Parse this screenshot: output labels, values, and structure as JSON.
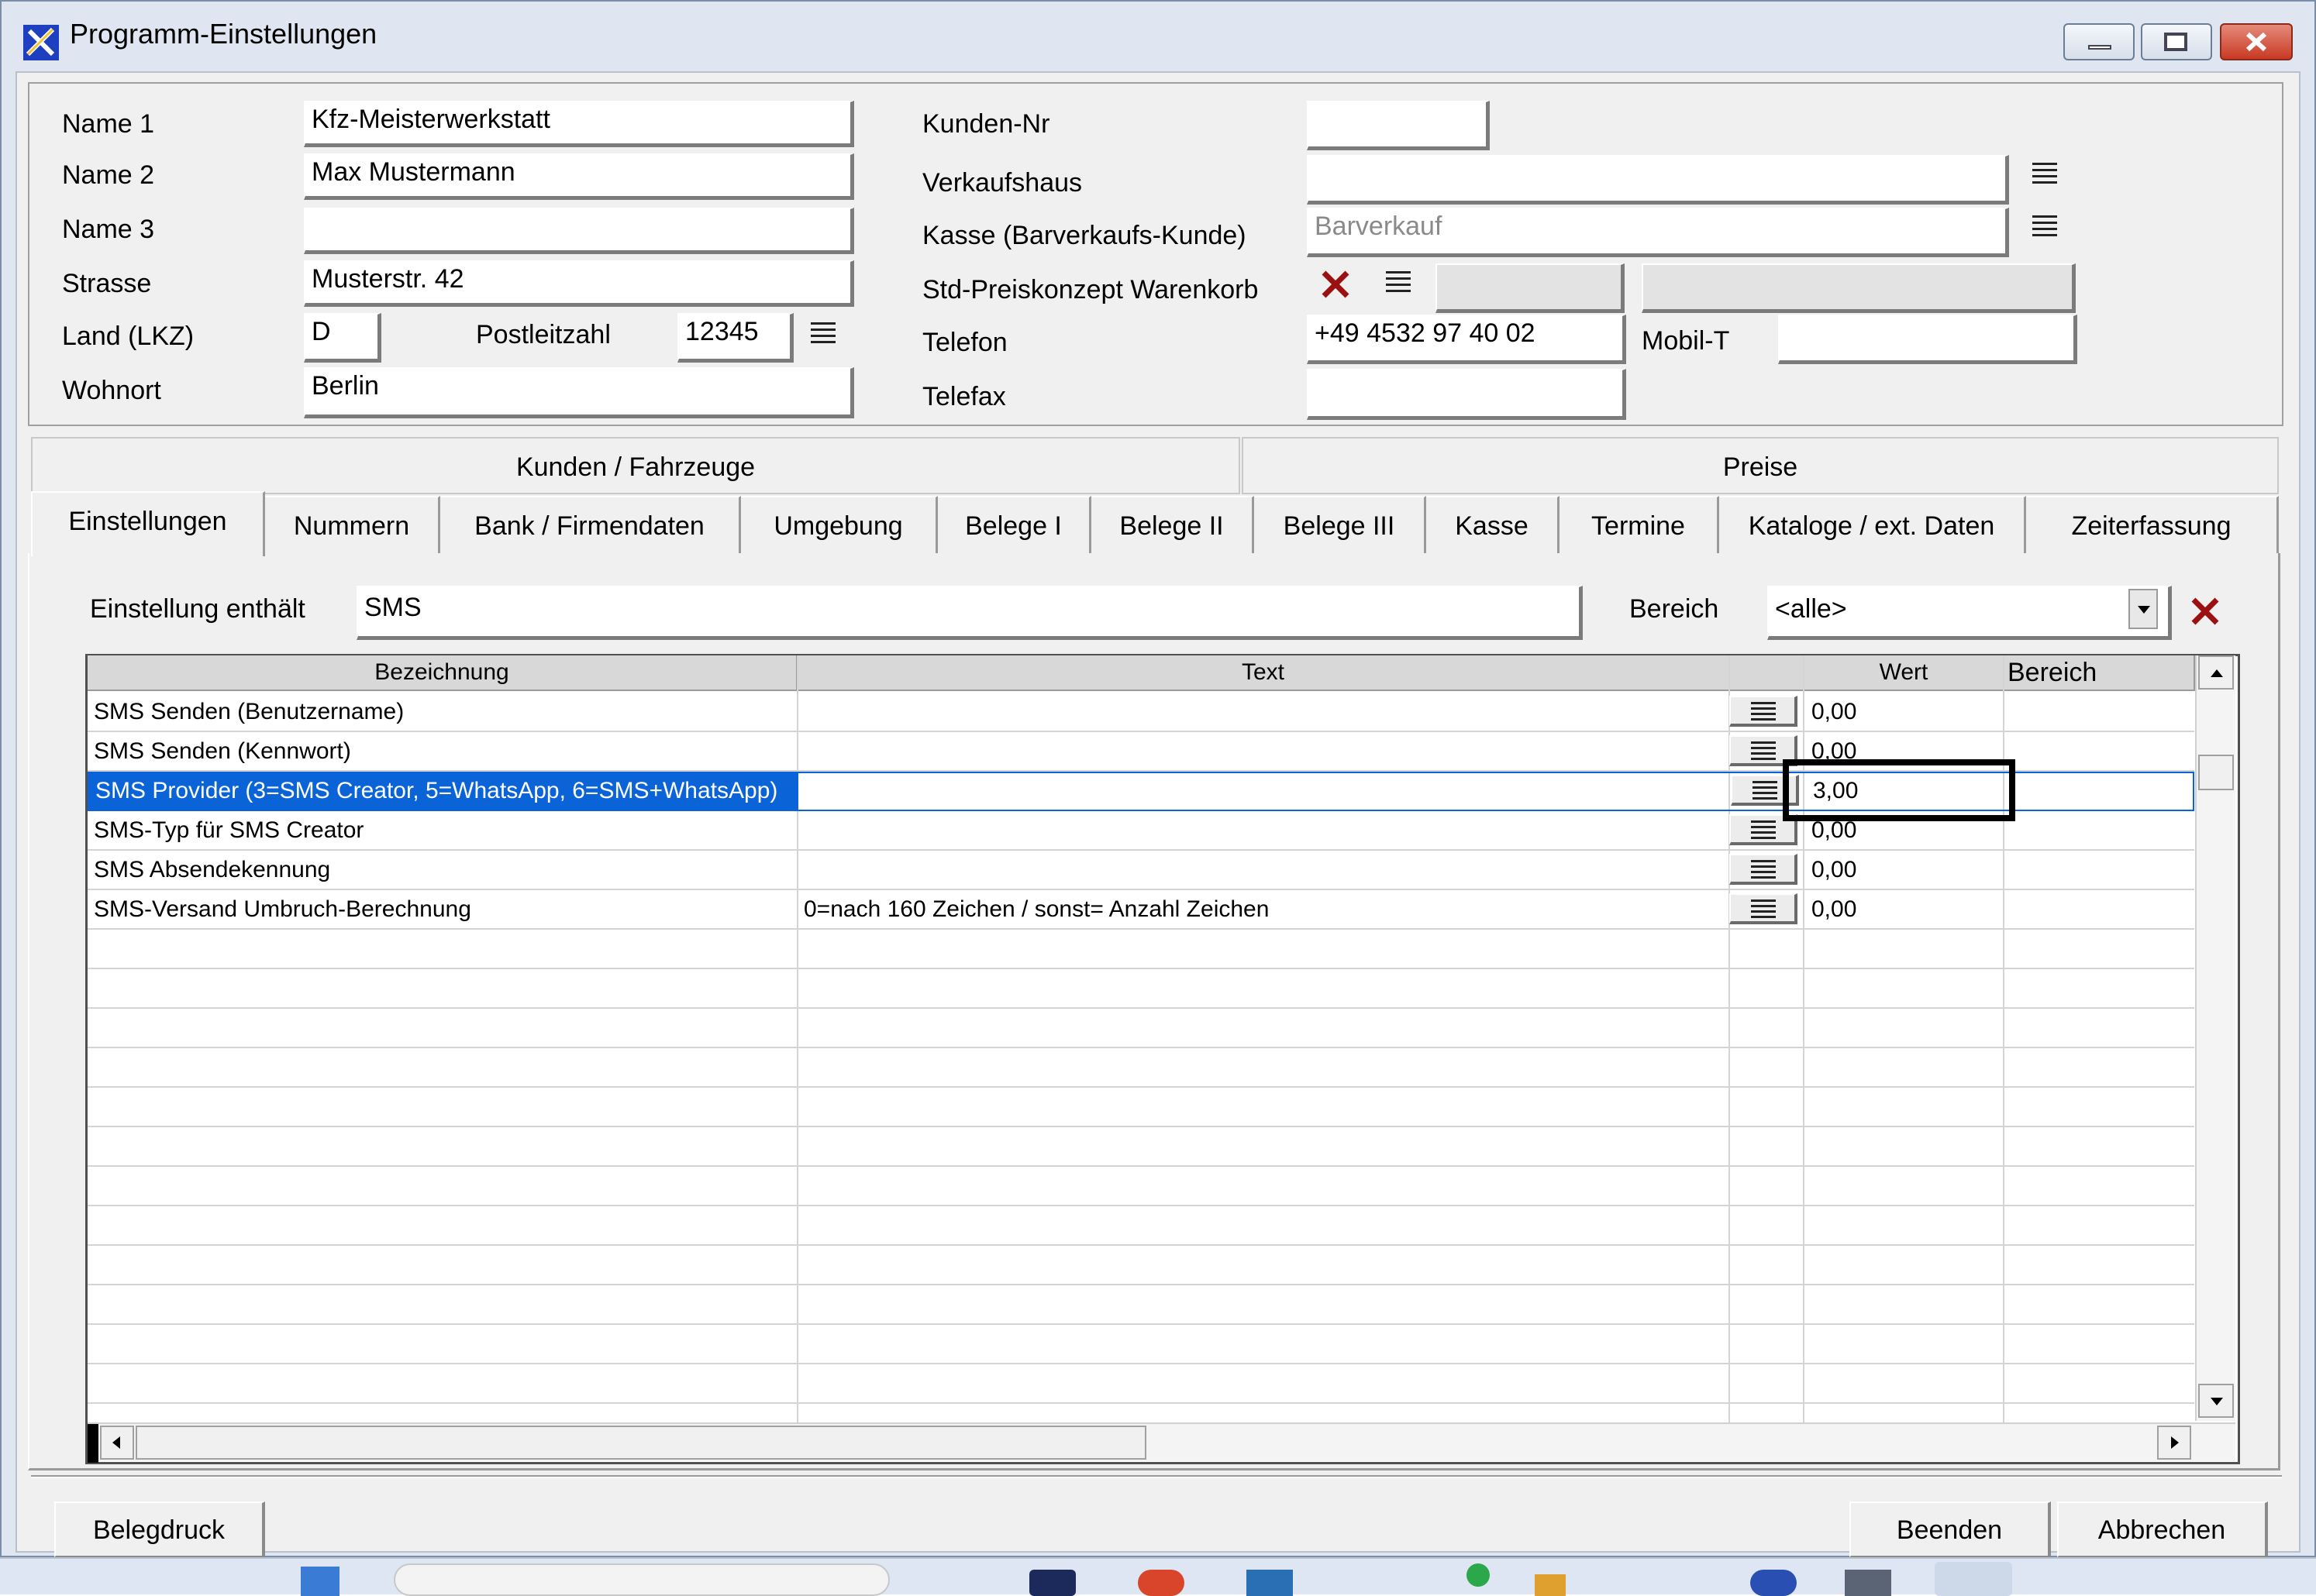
{
  "window": {
    "title": "Programm-Einstellungen"
  },
  "form": {
    "name1_label": "Name 1",
    "name1_value": "Kfz-Meisterwerkstatt",
    "name2_label": "Name 2",
    "name2_value": "Max Mustermann",
    "name3_label": "Name 3",
    "name3_value": "",
    "strasse_label": "Strasse",
    "strasse_value": "Musterstr. 42",
    "land_label": "Land (LKZ)",
    "land_value": "D",
    "plz_label": "Postleitzahl",
    "plz_value": "12345",
    "wohnort_label": "Wohnort",
    "wohnort_value": "Berlin",
    "kundennr_label": "Kunden-Nr",
    "kundennr_value": "",
    "verkaufshaus_label": "Verkaufshaus",
    "verkaufshaus_value": "",
    "kasse_label": "Kasse (Barverkaufs-Kunde)",
    "kasse_placeholder": "Barverkauf",
    "preiskonzept_label": "Std-Preiskonzept Warenkorb",
    "telefon_label": "Telefon",
    "telefon_value": "+49 4532 97 40 02",
    "mobil_label": "Mobil-T",
    "mobil_value": "",
    "telefax_label": "Telefax",
    "telefax_value": ""
  },
  "header_tabs": [
    "Kunden / Fahrzeuge",
    "Preise"
  ],
  "tabs": [
    "Einstellungen",
    "Nummern",
    "Bank / Firmendaten",
    "Umgebung",
    "Belege I",
    "Belege II",
    "Belege III",
    "Kasse",
    "Termine",
    "Kataloge / ext. Daten",
    "Zeiterfassung"
  ],
  "filter": {
    "label": "Einstellung enthält",
    "value": "SMS",
    "bereich_label": "Bereich",
    "bereich_value": "<alle>"
  },
  "grid": {
    "columns": [
      "Bezeichnung",
      "Text",
      "",
      "Wert",
      "Bereich"
    ],
    "rows": [
      {
        "bezeichnung": "SMS Senden (Benutzername)",
        "text": "",
        "wert": "0,00",
        "bereich": ""
      },
      {
        "bezeichnung": "SMS Senden (Kennwort)",
        "text": "",
        "wert": "0,00",
        "bereich": ""
      },
      {
        "bezeichnung": "SMS Provider (3=SMS Creator, 5=WhatsApp, 6=SMS+WhatsApp)",
        "text": "",
        "wert": "3,00",
        "bereich": ""
      },
      {
        "bezeichnung": "SMS-Typ für SMS Creator",
        "text": "",
        "wert": "0,00",
        "bereich": ""
      },
      {
        "bezeichnung": "SMS Absendekennung",
        "text": "",
        "wert": "0,00",
        "bereich": ""
      },
      {
        "bezeichnung": "SMS-Versand Umbruch-Berechnung",
        "text": "0=nach 160 Zeichen / sonst= Anzahl Zeichen",
        "wert": "0,00",
        "bereich": ""
      }
    ],
    "selected_row": 2
  },
  "buttons": {
    "belegdruck": "Belegdruck",
    "beenden": "Beenden",
    "abbrechen": "Abbrechen"
  },
  "colors": {
    "selection": "#0a64d8",
    "delete_x": "#9b1010",
    "highlight_box": "#000000"
  }
}
